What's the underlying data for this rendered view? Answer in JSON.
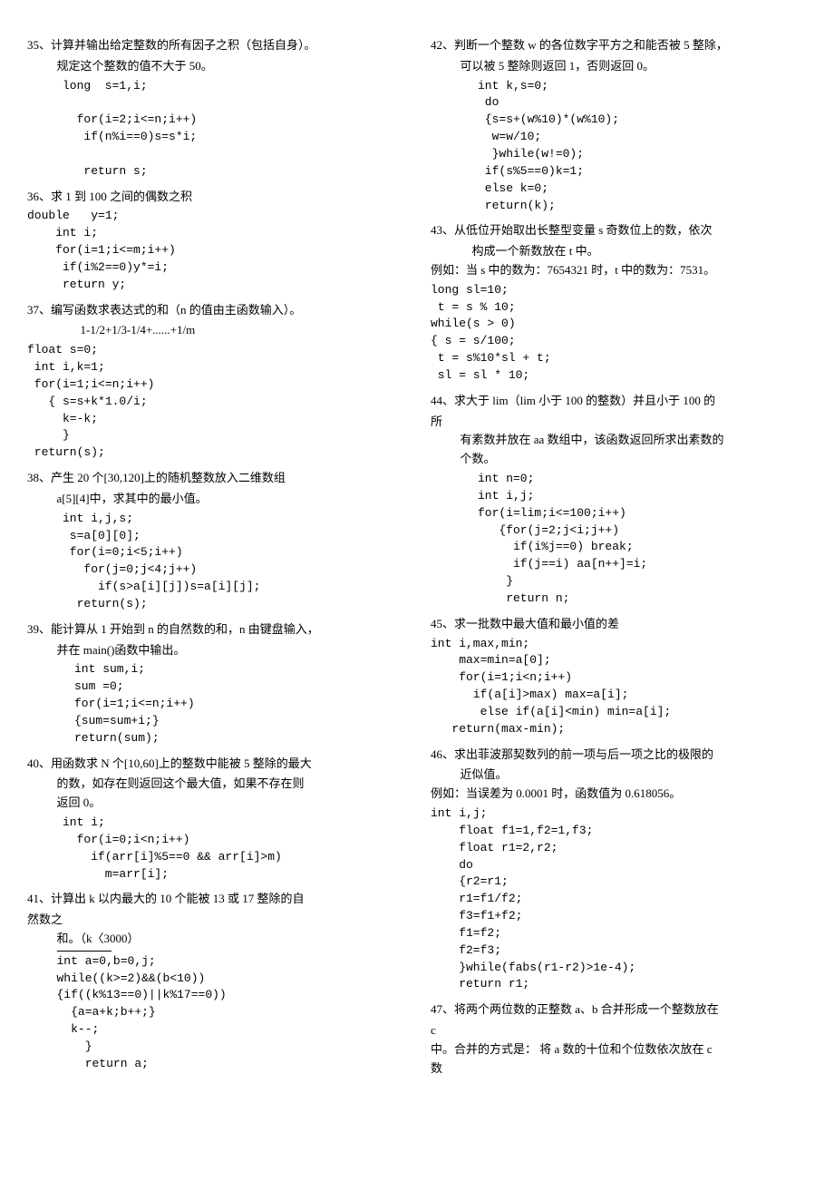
{
  "left": {
    "p35": {
      "title": "35、计算并输出给定整数的所有因子之积（包括自身）。",
      "sub": "规定这个整数的值不大于 50。",
      "code": "long  s=1,i;\n\n  for(i=2;i<=n;i++)\n   if(n%i==0)s=s*i;\n\n   return s;"
    },
    "p36": {
      "title": "36、求 1 到 100 之间的偶数之积",
      "code": "double   y=1;\n    int i;\n    for(i=1;i<=m;i++)\n     if(i%2==0)y*=i;\n     return y;"
    },
    "p37": {
      "title": "37、编写函数求表达式的和（n 的值由主函数输入）。",
      "sub": "1-1/2+1/3-1/4+......+1/m",
      "code": "float s=0;\n int i,k=1;\n for(i=1;i<=n;i++)\n   { s=s+k*1.0/i;\n     k=-k;\n     }\n return(s);"
    },
    "p38": {
      "title": "38、产生 20 个[30,120]上的随机整数放入二维数组",
      "sub": "a[5][4]中，求其中的最小值。",
      "code": "int i,j,s;\n s=a[0][0];\n for(i=0;i<5;i++)\n   for(j=0;j<4;j++)\n     if(s>a[i][j])s=a[i][j];\n  return(s);"
    },
    "p39": {
      "title": "39、能计算从 1 开始到 n 的自然数的和，n 由键盘输入，",
      "sub": "并在 main()函数中输出。",
      "code": "int sum,i;\nsum =0;\nfor(i=1;i<=n;i++)\n{sum=sum+i;}\nreturn(sum);"
    },
    "p40": {
      "title": "40、用函数求 N 个[10,60]上的整数中能被 5 整除的最大",
      "sub": "的数，如存在则返回这个最大值，如果不存在则",
      "sub2": "返回 0。",
      "code": "int i;\n  for(i=0;i<n;i++)\n    if(arr[i]%5==0 && arr[i]>m)\n      m=arr[i];"
    },
    "p41": {
      "title": "41、计算出 k 以内最大的 10 个能被 13 或 17 整除的自",
      "sub1": "然数之",
      "sub2": "和。（k〈3000）",
      "code": "int a=0,b=0,j;\nwhile((k>=2)&&(b<10))\n{if((k%13==0)||k%17==0))\n  {a=a+k;b++;}\n  k--;\n    }\n    return a;"
    }
  },
  "right": {
    "p42": {
      "title": "42、判断一个整数 w 的各位数字平方之和能否被 5 整除，",
      "sub": "可以被 5 整除则返回 1，否则返回 0。",
      "code": "int k,s=0;\n do\n {s=s+(w%10)*(w%10);\n  w=w/10;\n  }while(w!=0);\n if(s%5==0)k=1;\n else k=0;\n return(k);"
    },
    "p43": {
      "title": "43、从低位开始取出长整型变量 s 奇数位上的数，依次",
      "sub": "构成一个新数放在 t 中。",
      "ex": "例如：当 s 中的数为：7654321 时，t 中的数为：7531。",
      "code": "long sl=10;\n t = s % 10;\nwhile(s > 0)\n{ s = s/100;\n t = s%10*sl + t;\n sl = sl * 10;"
    },
    "p44": {
      "title": "44、求大于 lim（lim 小于 100 的整数）并且小于 100 的",
      "sub1": "所",
      "sub2": "有素数并放在 aa 数组中，该函数返回所求出素数的",
      "sub3": "个数。",
      "code": "int n=0;\nint i,j;\nfor(i=lim;i<=100;i++)\n   {for(j=2;j<i;j++)\n     if(i%j==0) break;\n     if(j==i) aa[n++]=i;\n    }\n    return n;"
    },
    "p45": {
      "title": "45、求一批数中最大值和最小值的差",
      "code": "int i,max,min;\n    max=min=a[0];\n    for(i=1;i<n;i++)\n      if(a[i]>max) max=a[i];\n       else if(a[i]<min) min=a[i];\n   return(max-min);"
    },
    "p46": {
      "title": "46、求出菲波那契数列的前一项与后一项之比的极限的",
      "sub": "近似值。",
      "ex": "例如：当误差为 0.0001 时，函数值为 0.618056。",
      "code": "int i,j;\n    float f1=1,f2=1,f3;\n    float r1=2,r2;\n    do\n    {r2=r1;\n    r1=f1/f2;\n    f3=f1+f2;\n    f1=f2;\n    f2=f3;\n    }while(fabs(r1-r2)>1e-4);\n    return r1;"
    },
    "p47": {
      "title": "47、将两个两位数的正整数 a、b 合并形成一个整数放在",
      "sub1": "c",
      "sub2": "中。合并的方式是：  将 a 数的十位和个位数依次放在 c",
      "sub3": "数"
    }
  }
}
